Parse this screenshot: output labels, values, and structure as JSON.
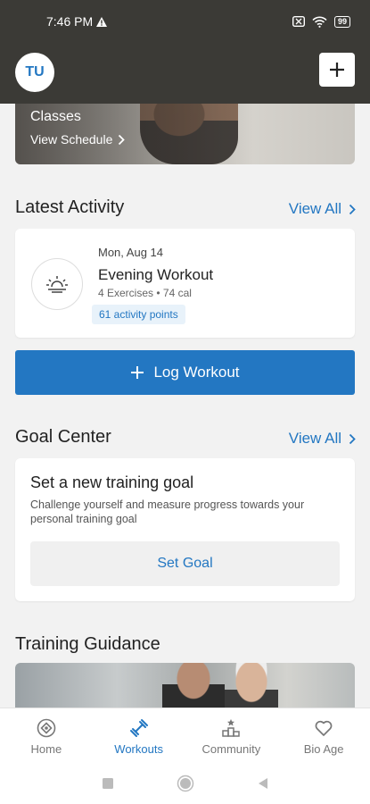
{
  "status_bar": {
    "time": "7:46 PM",
    "battery": "99"
  },
  "header": {
    "avatar_initials": "TU"
  },
  "classes": {
    "title": "Classes",
    "link": "View Schedule"
  },
  "latest_activity": {
    "title": "Latest Activity",
    "view_all": "View All",
    "date": "Mon, Aug 14",
    "workout_title": "Evening Workout",
    "meta": "4 Exercises • 74 cal",
    "badge": "61 activity points"
  },
  "log_workout": {
    "label": "Log Workout"
  },
  "goal_center": {
    "title": "Goal Center",
    "view_all": "View All",
    "card_title": "Set a new training goal",
    "card_desc": "Challenge yourself and measure progress towards your personal training goal",
    "button": "Set Goal"
  },
  "training_guidance": {
    "title": "Training Guidance"
  },
  "bottom_nav": {
    "items": [
      {
        "label": "Home",
        "icon": "home-icon"
      },
      {
        "label": "Workouts",
        "icon": "dumbbell-icon"
      },
      {
        "label": "Community",
        "icon": "community-icon"
      },
      {
        "label": "Bio Age",
        "icon": "heart-icon"
      }
    ],
    "active": "Workouts"
  },
  "colors": {
    "accent": "#2377c2",
    "header_bg": "#3b3a36",
    "page_bg": "#f2f2f2"
  }
}
